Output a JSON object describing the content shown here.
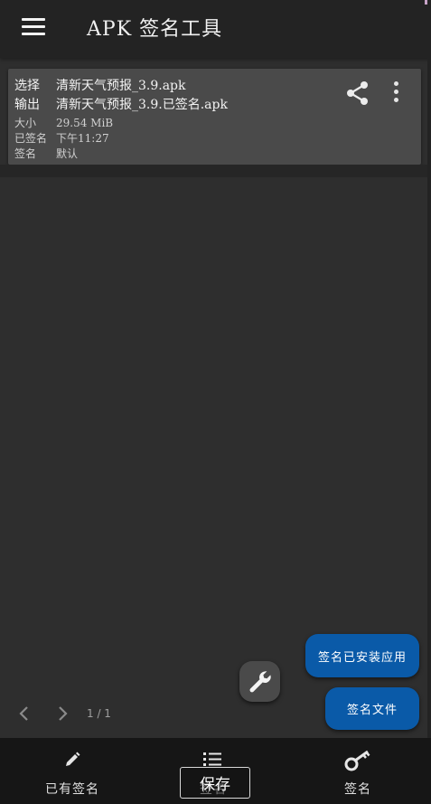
{
  "appbar": {
    "title": "APK 签名工具"
  },
  "apk_card": {
    "select_label": "选择",
    "select_value": "清新天气预报_3.9.apk",
    "output_label": "输出",
    "output_value": "清新天气预报_3.9.已签名.apk",
    "size_label": "大小",
    "size_value": "29.54 MiB",
    "signed_label": "已签名",
    "signed_value": "下午11:27",
    "sign_label": "签名",
    "sign_value": "默认"
  },
  "pager": {
    "label": "1 / 1"
  },
  "actions": {
    "sign_installed": "签名已安装应用",
    "sign_file": "签名文件"
  },
  "bottom_nav": {
    "signed": "已有签名",
    "list": "签名",
    "sign": "签名"
  },
  "save_button": "保存",
  "colors": {
    "accent": "#0a5aa8",
    "appbar": "#232323",
    "card": "#4a4a4a",
    "background": "#2e2e2e"
  }
}
